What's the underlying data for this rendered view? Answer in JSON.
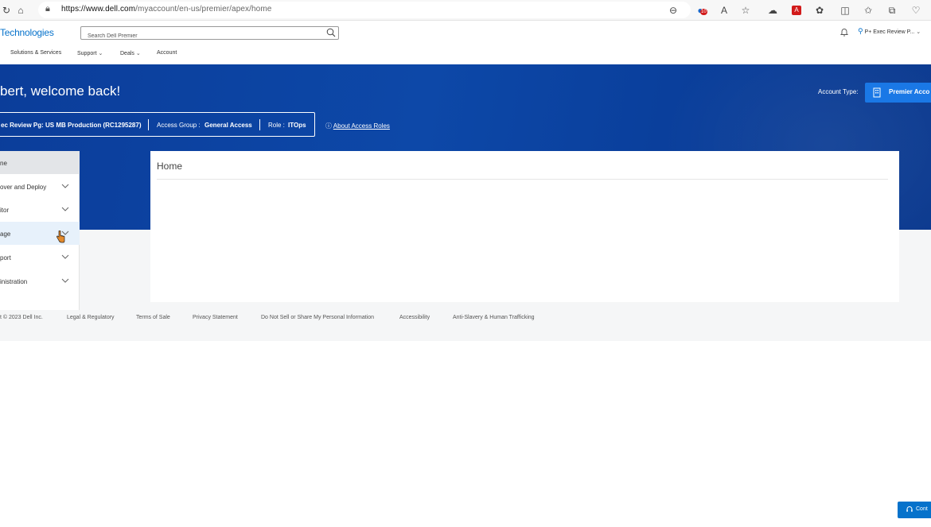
{
  "browser": {
    "url_host": "https://www.dell.com",
    "url_path": "/myaccount/en-us/premier/apex/home",
    "tracking_badge_count": "10"
  },
  "header": {
    "logo_text": "Technologies",
    "search_placeholder": "Search Dell Premier",
    "account_label": "P+ Exec Review P...",
    "nav": {
      "solutions": "Solutions & Services",
      "support": "Support",
      "deals": "Deals",
      "account": "Account"
    }
  },
  "hero": {
    "welcome": "bert, welcome back!",
    "account_type_label": "Account Type:",
    "account_type_value": "Premier Acco",
    "context": {
      "store": "ec Review Pg: US MB Production (RC1295287)",
      "access_group_label": "Access Group :",
      "access_group_value": "General Access",
      "role_label": "Role :",
      "role_value": "ITOps"
    },
    "about_roles": "About Access Roles"
  },
  "side_nav": {
    "items": [
      {
        "label": "ne"
      },
      {
        "label": "over and Deploy"
      },
      {
        "label": "itor"
      },
      {
        "label": "age"
      },
      {
        "label": "port"
      },
      {
        "label": "inistration"
      }
    ]
  },
  "main": {
    "title": "Home"
  },
  "footer": {
    "copyright": "t © 2023 Dell Inc.",
    "legal": "Legal & Regulatory",
    "terms": "Terms of Sale",
    "privacy": "Privacy Statement",
    "do_not_sell": "Do Not Sell or Share My Personal Information",
    "accessibility": "Accessibility",
    "anti_slavery": "Anti-Slavery & Human Trafficking"
  },
  "contact_button": {
    "label": "Cont"
  },
  "colors": {
    "dell_blue": "#0672cb",
    "hero_blue": "#0b3d9a",
    "premier_button": "#1a78e6"
  }
}
